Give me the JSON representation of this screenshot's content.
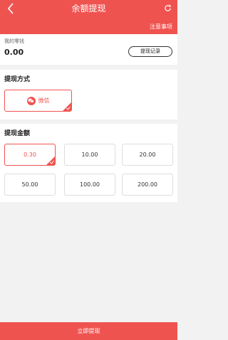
{
  "header": {
    "title": "余额提现",
    "notice_label": "注意事项",
    "back_icon": "chevron-left-icon",
    "refresh_icon": "refresh-icon"
  },
  "balance": {
    "label": "我的零钱",
    "value": "0.00",
    "record_button": "提现记录"
  },
  "method": {
    "title": "提现方式",
    "options": [
      {
        "label": "微信",
        "selected": true,
        "icon": "wechat-icon"
      }
    ]
  },
  "amount": {
    "title": "提现金额",
    "options": [
      {
        "label": "0.30",
        "selected": true
      },
      {
        "label": "10.00",
        "selected": false
      },
      {
        "label": "20.00",
        "selected": false
      },
      {
        "label": "50.00",
        "selected": false
      },
      {
        "label": "100.00",
        "selected": false
      },
      {
        "label": "200.00",
        "selected": false
      }
    ]
  },
  "submit_label": "立即提现",
  "colors": {
    "accent": "#ef5350",
    "background": "#f2f2f2"
  }
}
